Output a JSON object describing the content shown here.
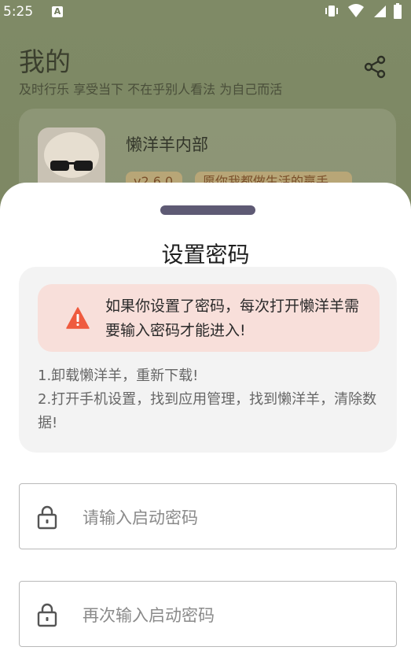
{
  "status_bar": {
    "time": "5:25",
    "notification_badge": "A",
    "icons": [
      "vibrate-icon",
      "wifi-icon",
      "signal-icon",
      "battery-icon"
    ]
  },
  "page": {
    "title": "我的",
    "subtitle": "及时行乐 享受当下 不在乎别人看法 为自己而活",
    "share_icon": "share-icon"
  },
  "profile": {
    "app_name": "懒洋羊内部",
    "version_tag": "v2.6.0",
    "slogan_tag": "愿你我都做生活的赢手"
  },
  "sheet": {
    "title": "设置密码",
    "warning": {
      "icon": "warning-icon",
      "text": "如果你设置了密码，每次打开懒洋羊需要输入密码才能进入!"
    },
    "notes": [
      "1.卸载懒洋羊，重新下载!",
      "2.打开手机设置，找到应用管理，找到懒洋羊，清除数据!"
    ],
    "password_field": {
      "placeholder": "请输入启动密码",
      "icon": "lock-icon"
    },
    "confirm_field": {
      "placeholder": "再次输入启动密码",
      "icon": "lock-icon"
    }
  },
  "colors": {
    "sheet_bg": "#ffffff",
    "warning_bg": "#f8dfda",
    "warning_icon": "#ef5b3f",
    "handle": "#5e5a74",
    "info_box_bg": "#f3f3f3"
  }
}
